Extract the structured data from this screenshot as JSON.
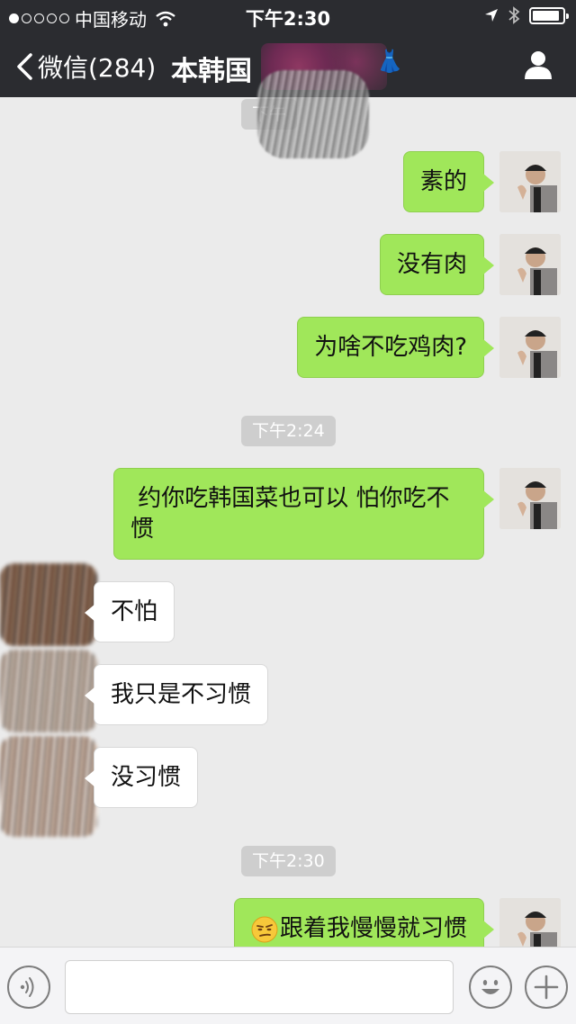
{
  "status_bar": {
    "carrier": "中国移动",
    "time": "下午2:30",
    "signal_bars_filled": 1,
    "signal_bars_total": 5,
    "battery_level": 0.9
  },
  "nav": {
    "back_label": "微信(284)",
    "title": "本韩国",
    "icons": [
      "chevron-left-icon",
      "person-icon"
    ]
  },
  "messages": [
    {
      "side": "me",
      "text": "素的"
    },
    {
      "side": "me",
      "text": "没有肉"
    },
    {
      "side": "me",
      "text": "为啥不吃鸡肉?"
    },
    {
      "timestamp": "下午2:24"
    },
    {
      "side": "me",
      "text": " 约你吃韩国菜也可以 怕你吃不惯"
    },
    {
      "side": "them",
      "text": "不怕"
    },
    {
      "side": "them",
      "text": "我只是不习惯"
    },
    {
      "side": "them",
      "text": "没习惯"
    },
    {
      "timestamp": "下午2:30"
    },
    {
      "side": "me",
      "emoji": "smirk-emoji",
      "text": "跟着我慢慢就习惯"
    }
  ],
  "partial_timestamp": "下午",
  "input_bar": {
    "icons": [
      "voice-icon",
      "emoji-icon",
      "plus-icon"
    ],
    "text_value": ""
  },
  "colors": {
    "header_bg": "#2b2c30",
    "chat_bg": "#ebebeb",
    "my_bubble": "#a0e75a",
    "their_bubble": "#ffffff"
  }
}
